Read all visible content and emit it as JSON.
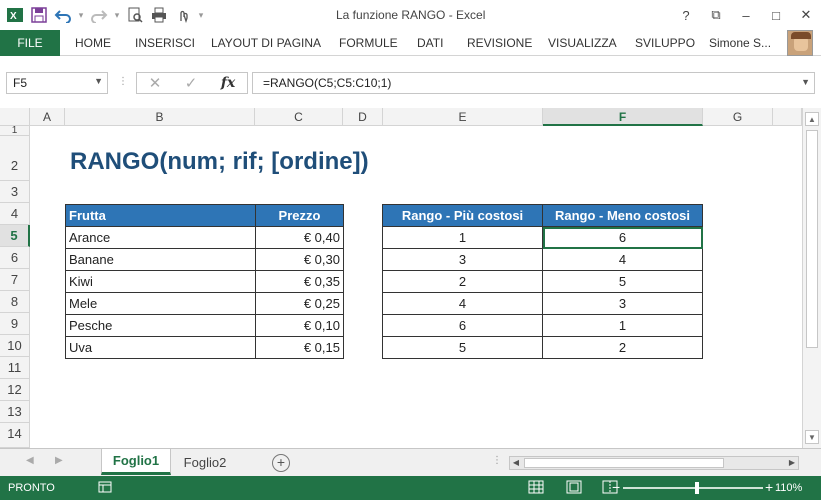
{
  "window": {
    "title": "La funzione RANGO - Excel",
    "controls": [
      "?",
      "⧉",
      "–",
      "□",
      "✕"
    ]
  },
  "ribbon": {
    "file": "FILE",
    "tabs": [
      "HOME",
      "INSERISCI",
      "LAYOUT DI PAGINA",
      "FORMULE",
      "DATI",
      "REVISIONE",
      "VISUALIZZA",
      "SVILUPPO"
    ],
    "user": "Simone S..."
  },
  "formula_bar": {
    "name_box": "F5",
    "formula": "=RANGO(C5;C5:C10;1)"
  },
  "columns": [
    "A",
    "B",
    "C",
    "D",
    "E",
    "F",
    "G"
  ],
  "rows": [
    "1",
    "2",
    "3",
    "4",
    "5",
    "6",
    "7",
    "8",
    "9",
    "10",
    "11",
    "12",
    "13",
    "14"
  ],
  "sheet": {
    "title": "RANGO(num; rif; [ordine])",
    "table1": {
      "headers": [
        "Frutta",
        "Prezzo"
      ],
      "rows": [
        [
          "Arance",
          "€ 0,40"
        ],
        [
          "Banane",
          "€ 0,30"
        ],
        [
          "Kiwi",
          "€ 0,35"
        ],
        [
          "Mele",
          "€ 0,25"
        ],
        [
          "Pesche",
          "€ 0,10"
        ],
        [
          "Uva",
          "€ 0,15"
        ]
      ]
    },
    "table2": {
      "headers": [
        "Rango - Più costosi",
        "Rango - Meno costosi"
      ],
      "rows": [
        [
          "1",
          "6"
        ],
        [
          "3",
          "4"
        ],
        [
          "2",
          "5"
        ],
        [
          "4",
          "3"
        ],
        [
          "6",
          "1"
        ],
        [
          "5",
          "2"
        ]
      ]
    }
  },
  "sheet_tabs": [
    "Foglio1",
    "Foglio2"
  ],
  "status": {
    "ready": "PRONTO",
    "zoom": "110%"
  },
  "colors": {
    "excel_green": "#217346",
    "header_blue": "#2e75b6",
    "title_blue": "#1f4e79"
  }
}
